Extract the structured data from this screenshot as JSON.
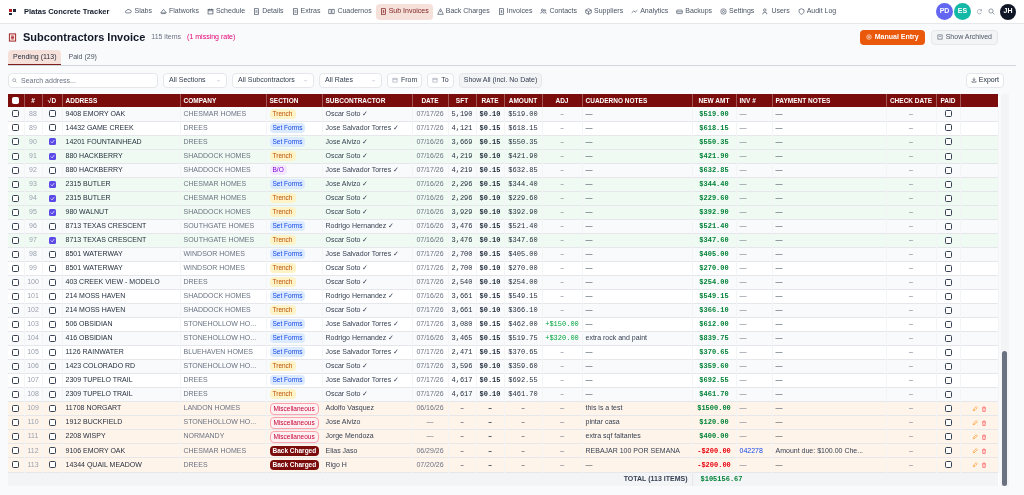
{
  "app": {
    "title": "Platas Concrete Tracker"
  },
  "nav": [
    {
      "label": "Slabs",
      "selected": false
    },
    {
      "label": "Flatworks",
      "selected": false
    },
    {
      "label": "Schedule",
      "selected": false
    },
    {
      "label": "Details",
      "selected": false
    },
    {
      "label": "Extras",
      "selected": false
    },
    {
      "label": "Cuadernos",
      "selected": false
    },
    {
      "label": "Sub Invoices",
      "selected": true
    },
    {
      "label": "Back Charges",
      "selected": false
    },
    {
      "label": "Invoices",
      "selected": false
    },
    {
      "label": "Contacts",
      "selected": false
    },
    {
      "label": "Suppliers",
      "selected": false
    },
    {
      "label": "Analytics",
      "selected": false
    },
    {
      "label": "Backups",
      "selected": false
    },
    {
      "label": "Settings",
      "selected": false
    },
    {
      "label": "Users",
      "selected": false
    },
    {
      "label": "Audit Log",
      "selected": false
    }
  ],
  "presence": [
    {
      "initials": "PD",
      "color": "#6366f1"
    },
    {
      "initials": "ES",
      "color": "#14b8a6"
    }
  ],
  "user": {
    "initials": "JH"
  },
  "page": {
    "title": "Subcontractors Invoice",
    "count": "115 items",
    "warning": "(1 missing rate)",
    "primary_button": "Manual Entry",
    "secondary_button": "Show Archived"
  },
  "tabs": [
    {
      "label": "Pending (113)",
      "selected": true
    },
    {
      "label": "Paid (29)",
      "selected": false
    }
  ],
  "filters": {
    "search": {
      "placeholder": "Search address..."
    },
    "selects": [
      "All Sections",
      "All Subcontractors",
      "All Rates"
    ],
    "date_buttons": [
      "From",
      "To"
    ],
    "show_all": "Show All (incl. No Date)",
    "export": "Export"
  },
  "table": {
    "all_selected": false,
    "columns": [
      "#",
      "√D",
      "ADDRESS",
      "COMPANY",
      "SECTION",
      "SUBCONTRACTOR",
      "DATE",
      "SFT",
      "RATE",
      "AMOUNT",
      "ADJ",
      "CUADERNO NOTES",
      "NEW AMT",
      "INV #",
      "PAYMENT NOTES",
      "CHECK DATE",
      "PAID"
    ],
    "rows": [
      {
        "num": "88",
        "verified": false,
        "address": "9408 EMORY OAK",
        "company": "CHESMAR HOMES",
        "section": {
          "kind": "trench",
          "label": "Trench"
        },
        "subcontractor": "Oscar Soto ✓",
        "date": "07/17/26",
        "sft": "5,190",
        "rate": "$0.10",
        "amount": "$519.00",
        "adj": "–",
        "adj_added": false,
        "cuaderno": "—",
        "new_amt": "$519.00",
        "negative": false,
        "inv": "—",
        "inv_linked": false,
        "payment_notes": "—",
        "check_date": "–",
        "selected": false,
        "paid": false,
        "editable": false
      },
      {
        "num": "89",
        "verified": false,
        "address": "14432 GAME CREEK",
        "company": "DREES",
        "section": {
          "kind": "set_forms",
          "label": "Set Forms"
        },
        "subcontractor": "Jose Salvador Torres ✓",
        "date": "07/17/26",
        "sft": "4,121",
        "rate": "$0.15",
        "amount": "$618.15",
        "adj": "–",
        "adj_added": false,
        "cuaderno": "—",
        "new_amt": "$618.15",
        "negative": false,
        "inv": "—",
        "inv_linked": false,
        "payment_notes": "—",
        "check_date": "–",
        "selected": false,
        "paid": false,
        "editable": false
      },
      {
        "num": "90",
        "verified": true,
        "address": "14201 FOUNTAINHEAD",
        "company": "DREES",
        "section": {
          "kind": "set_forms",
          "label": "Set Forms"
        },
        "subcontractor": "Jose Alvizo ✓",
        "date": "07/16/26",
        "sft": "3,669",
        "rate": "$0.15",
        "amount": "$550.35",
        "adj": "–",
        "adj_added": false,
        "cuaderno": "—",
        "new_amt": "$550.35",
        "negative": false,
        "inv": "—",
        "inv_linked": false,
        "payment_notes": "—",
        "check_date": "–",
        "selected": false,
        "paid": false,
        "editable": false
      },
      {
        "num": "91",
        "verified": true,
        "address": "880 HACKBERRY",
        "company": "SHADDOCK HOMES",
        "section": {
          "kind": "trench",
          "label": "Trench"
        },
        "subcontractor": "Oscar Soto ✓",
        "date": "07/16/26",
        "sft": "4,219",
        "rate": "$0.10",
        "amount": "$421.90",
        "adj": "–",
        "adj_added": false,
        "cuaderno": "—",
        "new_amt": "$421.90",
        "negative": false,
        "inv": "—",
        "inv_linked": false,
        "payment_notes": "—",
        "check_date": "–",
        "selected": false,
        "paid": false,
        "editable": false
      },
      {
        "num": "92",
        "verified": false,
        "address": "880 HACKBERRY",
        "company": "SHADDOCK HOMES",
        "section": {
          "kind": "bo",
          "label": "B/O"
        },
        "subcontractor": "Jose Salvador Torres ✓",
        "date": "07/17/26",
        "sft": "4,219",
        "rate": "$0.15",
        "amount": "$632.85",
        "adj": "–",
        "adj_added": false,
        "cuaderno": "—",
        "new_amt": "$632.85",
        "negative": false,
        "inv": "—",
        "inv_linked": false,
        "payment_notes": "—",
        "check_date": "–",
        "selected": false,
        "paid": false,
        "editable": false
      },
      {
        "num": "93",
        "verified": true,
        "address": "2315 BUTLER",
        "company": "CHESMAR HOMES",
        "section": {
          "kind": "set_forms",
          "label": "Set Forms"
        },
        "subcontractor": "Jose Alvizo ✓",
        "date": "07/16/26",
        "sft": "2,296",
        "rate": "$0.15",
        "amount": "$344.40",
        "adj": "–",
        "adj_added": false,
        "cuaderno": "—",
        "new_amt": "$344.40",
        "negative": false,
        "inv": "—",
        "inv_linked": false,
        "payment_notes": "—",
        "check_date": "–",
        "selected": false,
        "paid": false,
        "editable": false
      },
      {
        "num": "94",
        "verified": true,
        "address": "2315 BUTLER",
        "company": "CHESMAR HOMES",
        "section": {
          "kind": "trench",
          "label": "Trench"
        },
        "subcontractor": "Oscar Soto ✓",
        "date": "07/16/26",
        "sft": "2,296",
        "rate": "$0.10",
        "amount": "$229.60",
        "adj": "–",
        "adj_added": false,
        "cuaderno": "—",
        "new_amt": "$229.60",
        "negative": false,
        "inv": "—",
        "inv_linked": false,
        "payment_notes": "—",
        "check_date": "–",
        "selected": false,
        "paid": false,
        "editable": false
      },
      {
        "num": "95",
        "verified": true,
        "address": "980 WALNUT",
        "company": "SHADDOCK HOMES",
        "section": {
          "kind": "trench",
          "label": "Trench"
        },
        "subcontractor": "Oscar Soto ✓",
        "date": "07/16/26",
        "sft": "3,929",
        "rate": "$0.10",
        "amount": "$392.90",
        "adj": "–",
        "adj_added": false,
        "cuaderno": "—",
        "new_amt": "$392.90",
        "negative": false,
        "inv": "—",
        "inv_linked": false,
        "payment_notes": "—",
        "check_date": "–",
        "selected": false,
        "paid": false,
        "editable": false
      },
      {
        "num": "96",
        "verified": false,
        "address": "8713 TEXAS CRESCENT",
        "company": "SOUTHGATE HOMES",
        "section": {
          "kind": "set_forms",
          "label": "Set Forms"
        },
        "subcontractor": "Rodrigo Hernandez ✓",
        "date": "07/16/26",
        "sft": "3,476",
        "rate": "$0.15",
        "amount": "$521.40",
        "adj": "–",
        "adj_added": false,
        "cuaderno": "—",
        "new_amt": "$521.40",
        "negative": false,
        "inv": "—",
        "inv_linked": false,
        "payment_notes": "—",
        "check_date": "–",
        "selected": false,
        "paid": false,
        "editable": false
      },
      {
        "num": "97",
        "verified": true,
        "address": "8713 TEXAS CRESCENT",
        "company": "SOUTHGATE HOMES",
        "section": {
          "kind": "trench",
          "label": "Trench"
        },
        "subcontractor": "Oscar Soto ✓",
        "date": "07/16/26",
        "sft": "3,476",
        "rate": "$0.10",
        "amount": "$347.60",
        "adj": "–",
        "adj_added": false,
        "cuaderno": "—",
        "new_amt": "$347.60",
        "negative": false,
        "inv": "—",
        "inv_linked": false,
        "payment_notes": "—",
        "check_date": "–",
        "selected": false,
        "paid": false,
        "editable": false
      },
      {
        "num": "98",
        "verified": false,
        "address": "8501 WATERWAY",
        "company": "WINDSOR HOMES",
        "section": {
          "kind": "set_forms",
          "label": "Set Forms"
        },
        "subcontractor": "Jose Salvador Torres ✓",
        "date": "07/17/26",
        "sft": "2,700",
        "rate": "$0.15",
        "amount": "$405.00",
        "adj": "–",
        "adj_added": false,
        "cuaderno": "—",
        "new_amt": "$405.00",
        "negative": false,
        "inv": "—",
        "inv_linked": false,
        "payment_notes": "—",
        "check_date": "–",
        "selected": false,
        "paid": false,
        "editable": false
      },
      {
        "num": "99",
        "verified": false,
        "address": "8501 WATERWAY",
        "company": "WINDSOR HOMES",
        "section": {
          "kind": "trench",
          "label": "Trench"
        },
        "subcontractor": "Oscar Soto ✓",
        "date": "07/17/26",
        "sft": "2,700",
        "rate": "$0.10",
        "amount": "$270.00",
        "adj": "–",
        "adj_added": false,
        "cuaderno": "—",
        "new_amt": "$270.00",
        "negative": false,
        "inv": "—",
        "inv_linked": false,
        "payment_notes": "—",
        "check_date": "–",
        "selected": false,
        "paid": false,
        "editable": false
      },
      {
        "num": "100",
        "verified": false,
        "address": "403 CREEK VIEW - MODELO",
        "company": "DREES",
        "section": {
          "kind": "trench",
          "label": "Trench"
        },
        "subcontractor": "Oscar Soto ✓",
        "date": "07/17/26",
        "sft": "2,540",
        "rate": "$0.10",
        "amount": "$254.00",
        "adj": "–",
        "adj_added": false,
        "cuaderno": "—",
        "new_amt": "$254.00",
        "negative": false,
        "inv": "—",
        "inv_linked": false,
        "payment_notes": "—",
        "check_date": "–",
        "selected": false,
        "paid": false,
        "editable": false
      },
      {
        "num": "101",
        "verified": false,
        "address": "214 MOSS HAVEN",
        "company": "SHADDOCK HOMES",
        "section": {
          "kind": "set_forms",
          "label": "Set Forms"
        },
        "subcontractor": "Rodrigo Hernandez ✓",
        "date": "07/16/26",
        "sft": "3,661",
        "rate": "$0.15",
        "amount": "$549.15",
        "adj": "–",
        "adj_added": false,
        "cuaderno": "—",
        "new_amt": "$549.15",
        "negative": false,
        "inv": "—",
        "inv_linked": false,
        "payment_notes": "—",
        "check_date": "–",
        "selected": false,
        "paid": false,
        "editable": false
      },
      {
        "num": "102",
        "verified": false,
        "address": "214 MOSS HAVEN",
        "company": "SHADDOCK HOMES",
        "section": {
          "kind": "trench",
          "label": "Trench"
        },
        "subcontractor": "Oscar Soto ✓",
        "date": "07/17/26",
        "sft": "3,661",
        "rate": "$0.10",
        "amount": "$366.10",
        "adj": "–",
        "adj_added": false,
        "cuaderno": "—",
        "new_amt": "$366.10",
        "negative": false,
        "inv": "—",
        "inv_linked": false,
        "payment_notes": "—",
        "check_date": "–",
        "selected": false,
        "paid": false,
        "editable": false
      },
      {
        "num": "103",
        "verified": false,
        "address": "506 OBSIDIAN",
        "company": "STONEHOLLOW HO...",
        "section": {
          "kind": "set_forms",
          "label": "Set Forms"
        },
        "subcontractor": "Jose Salvador Torres ✓",
        "date": "07/17/26",
        "sft": "3,080",
        "rate": "$0.15",
        "amount": "$462.00",
        "adj": "+$150.00",
        "adj_added": true,
        "cuaderno": "—",
        "new_amt": "$612.00",
        "negative": false,
        "inv": "—",
        "inv_linked": false,
        "payment_notes": "—",
        "check_date": "–",
        "selected": false,
        "paid": false,
        "editable": false
      },
      {
        "num": "104",
        "verified": false,
        "address": "416 OBSIDIAN",
        "company": "STONEHOLLOW HO...",
        "section": {
          "kind": "set_forms",
          "label": "Set Forms"
        },
        "subcontractor": "Rodrigo Hernandez ✓",
        "date": "07/16/26",
        "sft": "3,465",
        "rate": "$0.15",
        "amount": "$519.75",
        "adj": "+$320.00",
        "adj_added": true,
        "cuaderno": "extra rock and paint",
        "new_amt": "$839.75",
        "negative": false,
        "inv": "—",
        "inv_linked": false,
        "payment_notes": "—",
        "check_date": "–",
        "selected": false,
        "paid": false,
        "editable": false
      },
      {
        "num": "105",
        "verified": false,
        "address": "1126 RAINWATER",
        "company": "BLUEHAVEN HOMES",
        "section": {
          "kind": "set_forms",
          "label": "Set Forms"
        },
        "subcontractor": "Jose Salvador Torres ✓",
        "date": "07/17/26",
        "sft": "2,471",
        "rate": "$0.15",
        "amount": "$370.65",
        "adj": "–",
        "adj_added": false,
        "cuaderno": "—",
        "new_amt": "$370.65",
        "negative": false,
        "inv": "—",
        "inv_linked": false,
        "payment_notes": "—",
        "check_date": "–",
        "selected": false,
        "paid": false,
        "editable": false
      },
      {
        "num": "106",
        "verified": false,
        "address": "1423 COLORADO RD",
        "company": "STONEHOLLOW HO...",
        "section": {
          "kind": "trench",
          "label": "Trench"
        },
        "subcontractor": "Oscar Soto ✓",
        "date": "07/17/26",
        "sft": "3,596",
        "rate": "$0.10",
        "amount": "$359.60",
        "adj": "–",
        "adj_added": false,
        "cuaderno": "—",
        "new_amt": "$359.60",
        "negative": false,
        "inv": "—",
        "inv_linked": false,
        "payment_notes": "—",
        "check_date": "–",
        "selected": false,
        "paid": false,
        "editable": false
      },
      {
        "num": "107",
        "verified": false,
        "address": "2309 TUPELO TRAIL",
        "company": "DREES",
        "section": {
          "kind": "set_forms",
          "label": "Set Forms"
        },
        "subcontractor": "Jose Salvador Torres ✓",
        "date": "07/17/26",
        "sft": "4,617",
        "rate": "$0.15",
        "amount": "$692.55",
        "adj": "–",
        "adj_added": false,
        "cuaderno": "—",
        "new_amt": "$692.55",
        "negative": false,
        "inv": "—",
        "inv_linked": false,
        "payment_notes": "—",
        "check_date": "–",
        "selected": false,
        "paid": false,
        "editable": false
      },
      {
        "num": "108",
        "verified": false,
        "address": "2309 TUPELO TRAIL",
        "company": "DREES",
        "section": {
          "kind": "trench",
          "label": "Trench"
        },
        "subcontractor": "Oscar Soto ✓",
        "date": "07/17/26",
        "sft": "4,617",
        "rate": "$0.10",
        "amount": "$461.70",
        "adj": "–",
        "adj_added": false,
        "cuaderno": "—",
        "new_amt": "$461.70",
        "negative": false,
        "inv": "—",
        "inv_linked": false,
        "payment_notes": "—",
        "check_date": "–",
        "selected": false,
        "paid": false,
        "editable": false
      },
      {
        "num": "109",
        "verified": false,
        "address": "11708 NORGART",
        "company": "LANDON HOMES",
        "section": {
          "kind": "misc",
          "label": "Miscellaneous"
        },
        "subcontractor": "Adolfo Vasquez",
        "date": "06/16/26",
        "sft": "–",
        "rate": "–",
        "amount": "–",
        "adj": "—",
        "adj_added": false,
        "cuaderno": "this is a test",
        "new_amt": "$1500.00",
        "negative": false,
        "inv": "—",
        "inv_linked": false,
        "payment_notes": "—",
        "check_date": "–",
        "selected": false,
        "paid": false,
        "editable": true
      },
      {
        "num": "110",
        "verified": false,
        "address": "1912 BUCKFIELD",
        "company": "STONEHOLLOW HO...",
        "section": {
          "kind": "misc",
          "label": "Miscellaneous"
        },
        "subcontractor": "Jose Alvizo",
        "date": "—",
        "sft": "–",
        "rate": "–",
        "amount": "–",
        "adj": "—",
        "adj_added": false,
        "cuaderno": "pintar casa",
        "new_amt": "$120.00",
        "negative": false,
        "inv": "—",
        "inv_linked": false,
        "payment_notes": "—",
        "check_date": "–",
        "selected": false,
        "paid": false,
        "editable": true
      },
      {
        "num": "111",
        "verified": false,
        "address": "2208 WISPY",
        "company": "NORMANDY",
        "section": {
          "kind": "misc",
          "label": "Miscellaneous"
        },
        "subcontractor": "Jorge Mendoza",
        "date": "—",
        "sft": "–",
        "rate": "–",
        "amount": "–",
        "adj": "—",
        "adj_added": false,
        "cuaderno": "extra sqf faltantes",
        "new_amt": "$400.00",
        "negative": false,
        "inv": "—",
        "inv_linked": false,
        "payment_notes": "—",
        "check_date": "–",
        "selected": false,
        "paid": false,
        "editable": true
      },
      {
        "num": "112",
        "verified": false,
        "address": "9106 EMORY OAK",
        "company": "CHESMAR HOMES",
        "section": {
          "kind": "back_charged",
          "label": "Back Charged"
        },
        "subcontractor": "Elias Jaso",
        "date": "06/29/26",
        "sft": "–",
        "rate": "–",
        "amount": "–",
        "adj": "—",
        "adj_added": false,
        "cuaderno": "REBAJAR 100 POR SEMANA",
        "new_amt": "-$200.00",
        "negative": true,
        "inv": "042278",
        "inv_linked": true,
        "payment_notes": "Amount due: $100.00 Che...",
        "check_date": "–",
        "selected": false,
        "paid": false,
        "editable": true
      },
      {
        "num": "113",
        "verified": false,
        "address": "14344 QUAIL MEADOW",
        "company": "DREES",
        "section": {
          "kind": "back_charged",
          "label": "Back Charged"
        },
        "subcontractor": "Rigo H",
        "date": "07/20/26",
        "sft": "–",
        "rate": "–",
        "amount": "–",
        "adj": "—",
        "adj_added": false,
        "cuaderno": "—",
        "new_amt": "-$200.00",
        "negative": true,
        "inv": "—",
        "inv_linked": false,
        "payment_notes": "—",
        "check_date": "–",
        "selected": false,
        "paid": false,
        "editable": true
      }
    ],
    "total": {
      "label": "TOTAL (113 ITEMS)",
      "value": "$105156.67"
    }
  }
}
